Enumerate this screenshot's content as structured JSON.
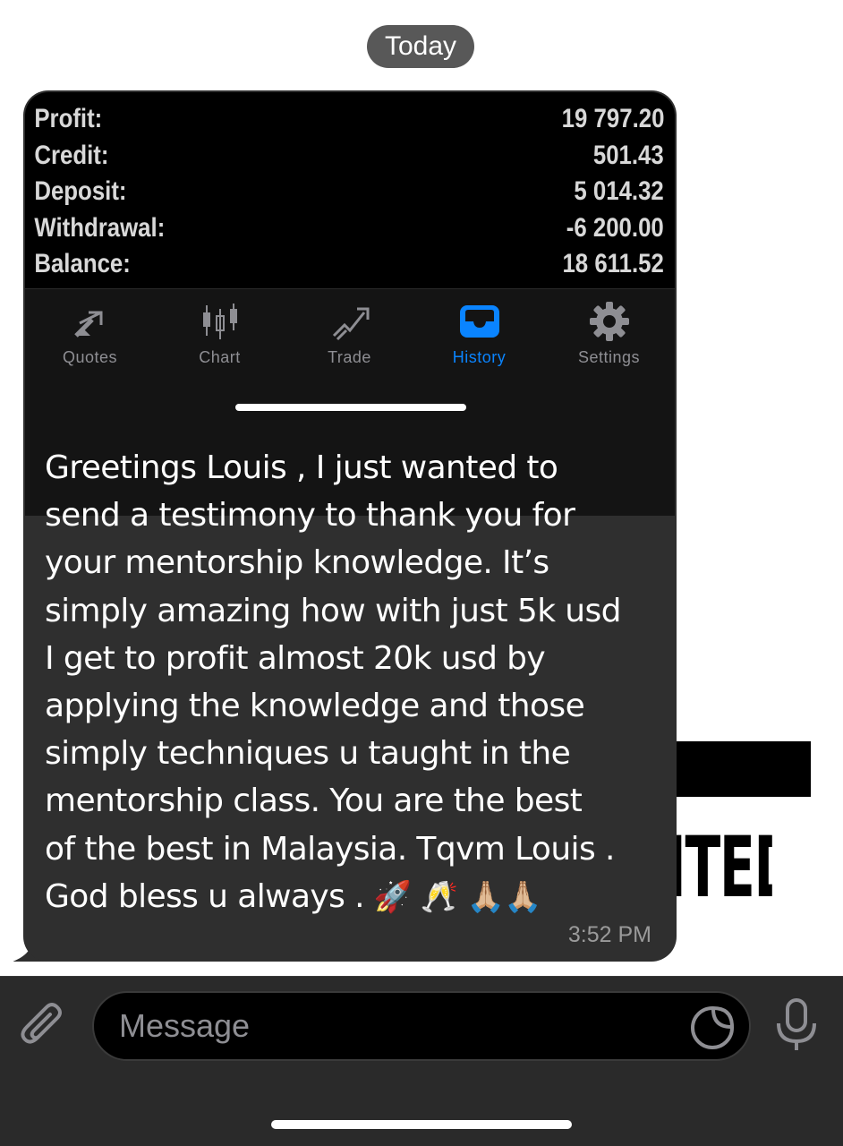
{
  "date_separator": "Today",
  "wallpaper_fragment": "ITED",
  "screenshot": {
    "summary": [
      {
        "label": "Profit:",
        "value": "19 797.20"
      },
      {
        "label": "Credit:",
        "value": "501.43"
      },
      {
        "label": "Deposit:",
        "value": "5 014.32"
      },
      {
        "label": "Withdrawal:",
        "value": "-6 200.00"
      },
      {
        "label": "Balance:",
        "value": "18 611.52"
      }
    ],
    "tabs": [
      {
        "label": "Quotes",
        "icon": "quotes-icon"
      },
      {
        "label": "Chart",
        "icon": "chart-candles-icon"
      },
      {
        "label": "Trade",
        "icon": "trade-icon"
      },
      {
        "label": "History",
        "icon": "history-inbox-icon",
        "active": true
      },
      {
        "label": "Settings",
        "icon": "gear-icon"
      }
    ],
    "colors": {
      "active_tab": "#0a84ff",
      "inactive_tab": "#8e8e93"
    }
  },
  "message": {
    "lines": [
      "Greetings Louis , I just wanted to",
      "send a testimony to thank you for",
      "your mentorship knowledge. It’s",
      "simply amazing how with just 5k usd",
      "I get to profit almost 20k usd by",
      "applying the knowledge and those",
      "simply techniques u taught in the",
      "mentorship class. You are the best",
      "of the best in Malaysia. Tqvm Louis .",
      "God bless u always ."
    ],
    "emojis": "🚀 🥂 🙏🏼🙏🏼",
    "time": "3:52 PM"
  },
  "composer": {
    "placeholder": "Message",
    "attach_icon": "paperclip-icon",
    "sticker_icon": "sticker-icon",
    "mic_icon": "microphone-icon"
  }
}
